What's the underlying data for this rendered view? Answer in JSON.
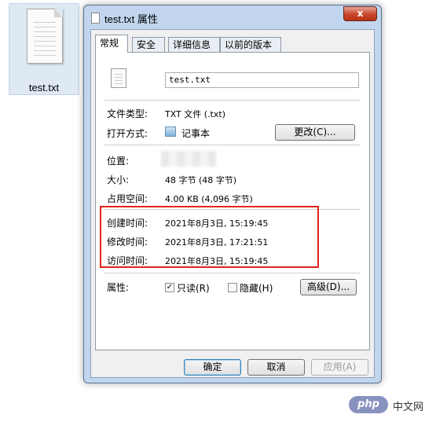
{
  "desktop": {
    "file_name": "test.txt"
  },
  "window": {
    "title": "test.txt 属性",
    "close_label": "x"
  },
  "tabs": [
    "常规",
    "安全",
    "详细信息",
    "以前的版本"
  ],
  "general": {
    "file_name_value": "test.txt",
    "rows": {
      "type_label": "文件类型:",
      "type_value": "TXT 文件 (.txt)",
      "open_label": "打开方式:",
      "open_value": "记事本",
      "change_button": "更改(C)...",
      "location_label": "位置:",
      "size_label": "大小:",
      "size_value": "48 字节 (48 字节)",
      "disk_label": "占用空间:",
      "disk_value": "4.00 KB (4,096 字节)",
      "created_label": "创建时间:",
      "created_value": "2021年8月3日, 15:19:45",
      "modified_label": "修改时间:",
      "modified_value": "2021年8月3日, 17:21:51",
      "accessed_label": "访问时间:",
      "accessed_value": "2021年8月3日, 15:19:45",
      "attr_label": "属性:",
      "readonly_label": "只读(R)",
      "hidden_label": "隐藏(H)",
      "advanced_button": "高级(D)..."
    },
    "readonly_checked": true,
    "hidden_checked": false
  },
  "footer": {
    "ok": "确定",
    "cancel": "取消",
    "apply": "应用(A)"
  },
  "watermark": {
    "brand": "php",
    "text": "中文网"
  },
  "colors": {
    "highlight_box": "#e2231a",
    "accent": "#3c7fb1"
  }
}
